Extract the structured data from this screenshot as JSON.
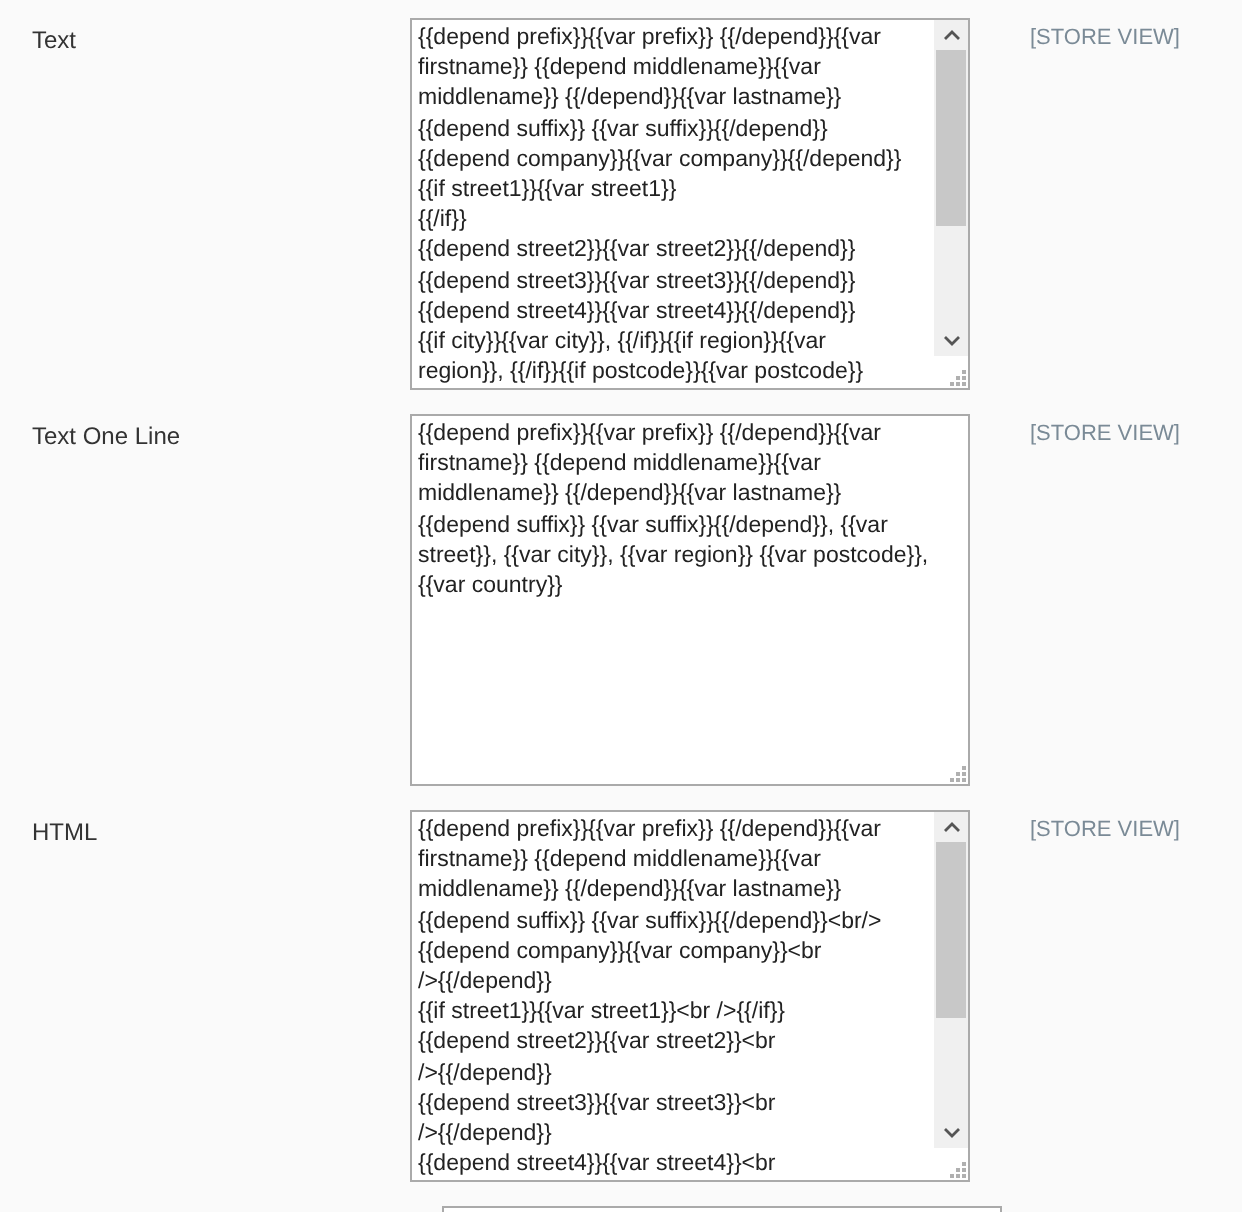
{
  "fields": [
    {
      "label": "Text",
      "scope": "[STORE VIEW]",
      "scrollable": true,
      "lines": [
        "{{depend prefix}}{{var prefix}} {{/depend}}{{var",
        "firstname}} {{depend middlename}}{{var",
        "middlename}} {{/depend}}{{var lastname}}",
        "{{depend suffix}} {{var suffix}}{{/depend}}",
        "{{depend company}}{{var company}}{{/depend}}",
        "{{if street1}}{{var street1}}",
        "{{/if}}",
        "{{depend street2}}{{var street2}}{{/depend}}",
        "{{depend street3}}{{var street3}}{{/depend}}",
        "{{depend street4}}{{var street4}}{{/depend}}",
        "{{if city}}{{var city}},  {{/if}}{{if region}}{{var",
        "region}}, {{/if}}{{if postcode}}{{var postcode}}"
      ]
    },
    {
      "label": "Text One Line",
      "scope": "[STORE VIEW]",
      "scrollable": false,
      "lines": [
        "{{depend prefix}}{{var prefix}} {{/depend}}{{var",
        "firstname}} {{depend middlename}}{{var",
        "middlename}} {{/depend}}{{var lastname}}",
        "{{depend suffix}} {{var suffix}}{{/depend}}, {{var",
        "street}}, {{var city}}, {{var region}} {{var postcode}},",
        "{{var country}}"
      ]
    },
    {
      "label": "HTML",
      "scope": "[STORE VIEW]",
      "scrollable": true,
      "lines": [
        "{{depend prefix}}{{var prefix}} {{/depend}}{{var",
        "firstname}} {{depend middlename}}{{var",
        "middlename}} {{/depend}}{{var lastname}}",
        "{{depend suffix}} {{var suffix}}{{/depend}}<br/>",
        "{{depend company}}{{var company}}<br",
        "/>{{/depend}}",
        "{{if street1}}{{var street1}}<br />{{/if}}",
        "{{depend street2}}{{var street2}}<br",
        "/>{{/depend}}",
        "{{depend street3}}{{var street3}}<br",
        "/>{{/depend}}",
        "{{depend street4}}{{var street4}}<br"
      ]
    }
  ]
}
